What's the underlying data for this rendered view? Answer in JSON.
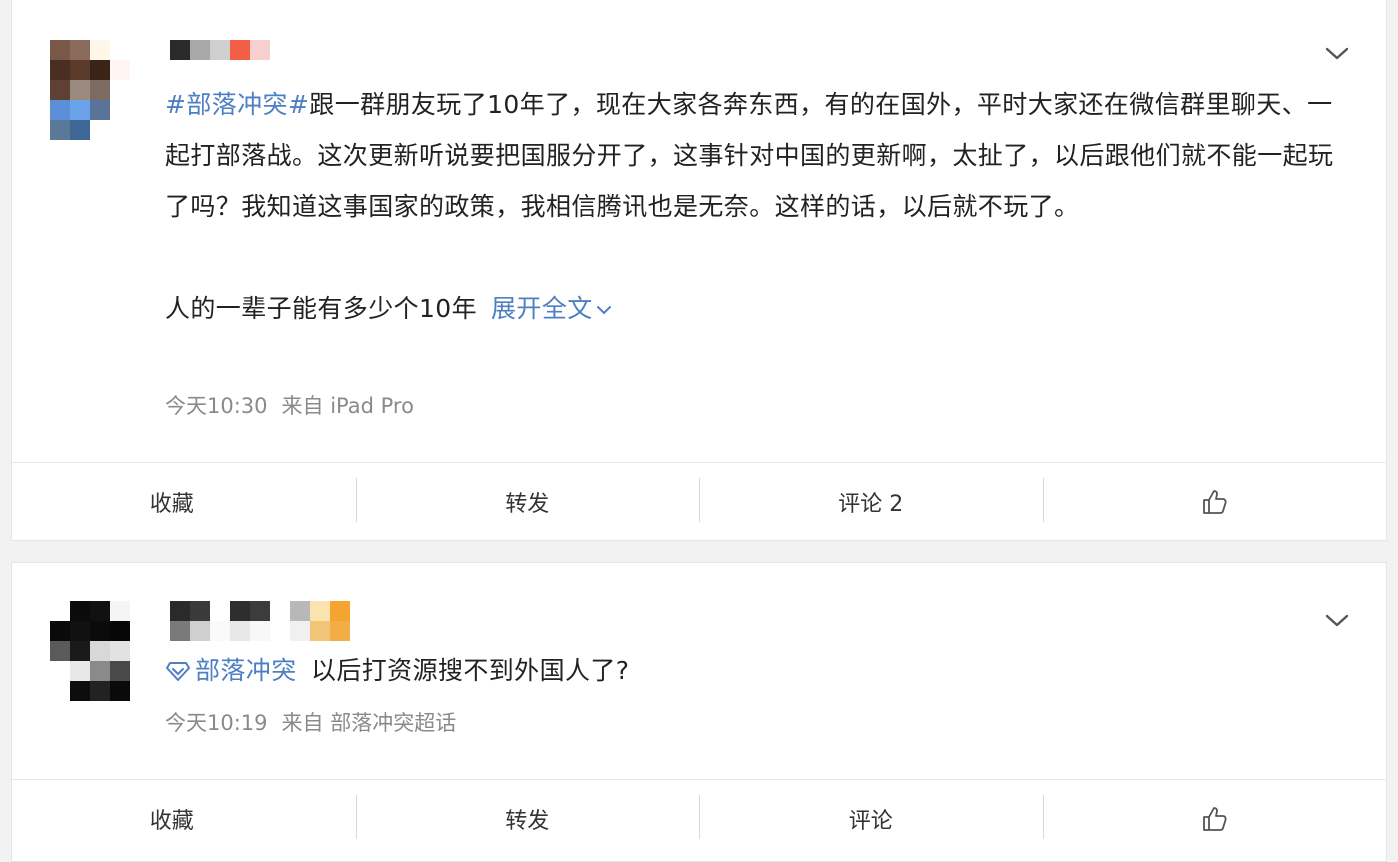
{
  "posts": [
    {
      "topic_tag": "#部落冲突#",
      "body": "跟一群朋友玩了10年了，现在大家各奔东西，有的在国外，平时大家还在微信群里聊天、一起打部落战。这次更新听说要把国服分开了，这事针对中国的更新啊，太扯了，以后跟他们就不能一起玩了吗？我知道这事国家的政策，我相信腾讯也是无奈。这样的话，以后就不玩了。",
      "body2": "人的一辈子能有多少个10年",
      "expand_label": "展开全文",
      "time": "今天10:30",
      "source": "来自 iPad Pro",
      "actions": {
        "favorite": "收藏",
        "repost": "转发",
        "comment": "评论 2"
      }
    },
    {
      "topic_tag": "部落冲突",
      "body": "以后打资源搜不到外国人了?",
      "time": "今天10:19",
      "source": "来自 部落冲突超话",
      "actions": {
        "favorite": "收藏",
        "repost": "转发",
        "comment": "评论"
      }
    }
  ],
  "icons": {
    "menu": "chevron-down-icon",
    "like": "thumbs-up-icon",
    "super_topic": "super-topic-icon"
  },
  "colors": {
    "link": "#4e7fc3",
    "text": "#222222",
    "meta": "#8a8a8a",
    "background": "#f2f2f2"
  }
}
